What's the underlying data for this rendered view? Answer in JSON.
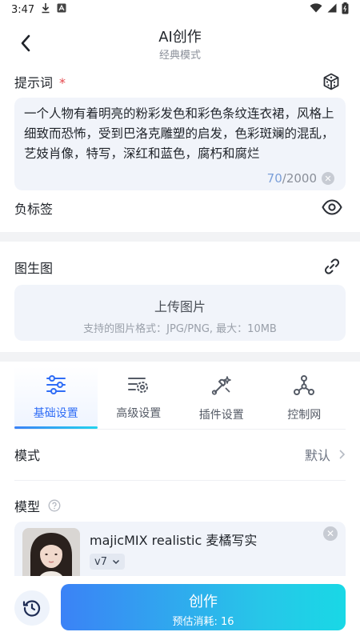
{
  "status_bar": {
    "time": "3:47"
  },
  "header": {
    "title": "AI创作",
    "subtitle": "经典模式"
  },
  "prompt": {
    "label": "提示词",
    "required_mark": "*",
    "text": "一个人物有着明亮的粉彩发色和彩色条纹连衣裙，风格上细致而恐怖，受到巴洛克雕塑的启发，色彩斑斓的混乱，艺妓肖像，特写，深红和蓝色，腐朽和腐烂",
    "count_current": "70",
    "count_max": "/2000"
  },
  "negative": {
    "label": "负标签"
  },
  "img2img": {
    "label": "图生图",
    "upload_title": "上传图片",
    "upload_hint": "支持的图片格式：JPG/PNG, 最大：10MB"
  },
  "tabs": [
    {
      "label": "基础设置",
      "icon": "sliders-icon"
    },
    {
      "label": "高级设置",
      "icon": "gear-settings-icon"
    },
    {
      "label": "插件设置",
      "icon": "tools-icon"
    },
    {
      "label": "控制网",
      "icon": "network-icon"
    }
  ],
  "mode": {
    "label": "模式",
    "value": "默认"
  },
  "model": {
    "label": "模型",
    "name": "majicMIX realistic 麦橘写实",
    "version": "v7"
  },
  "bottom": {
    "create_label": "创作",
    "cost_label": "预估消耗: 16"
  },
  "colors": {
    "accent": "#2f6df6",
    "gradient_end": "#19d8e6",
    "required": "#e5484d",
    "panel": "#f1f4fa"
  }
}
